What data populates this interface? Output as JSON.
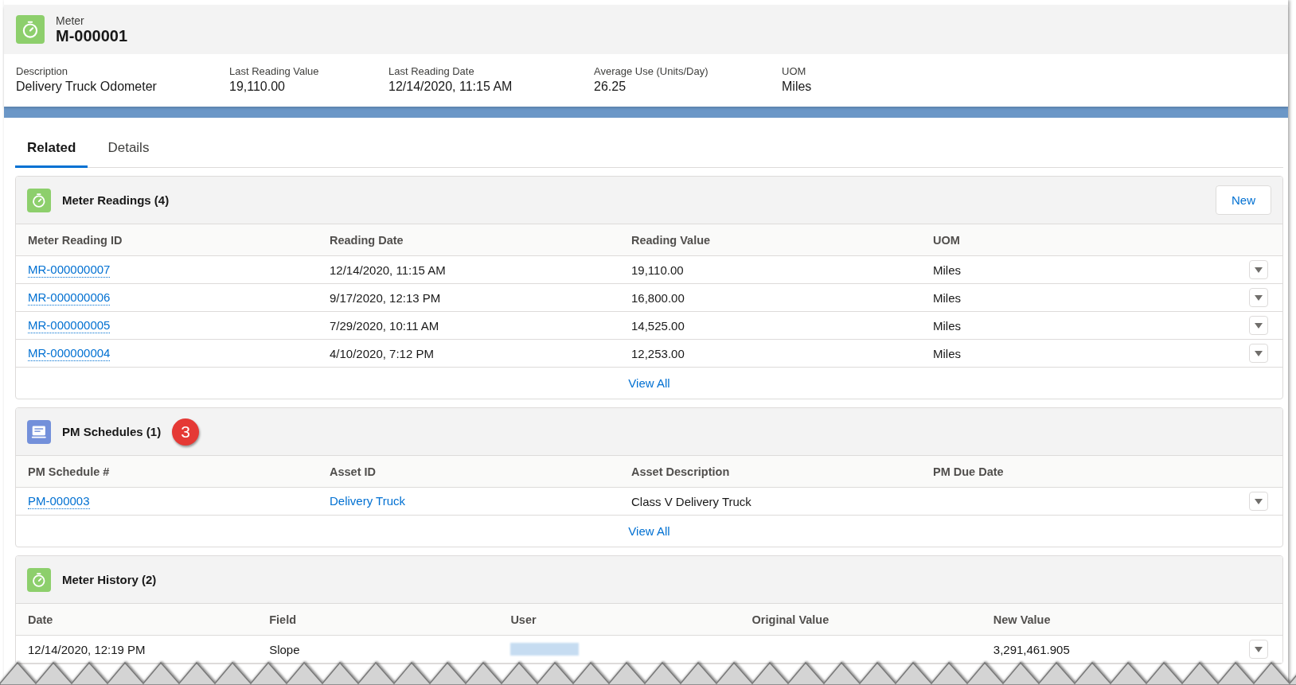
{
  "record": {
    "object_label": "Meter",
    "name": "M-000001",
    "kind": "meter"
  },
  "highlights": [
    {
      "label": "Description",
      "value": "Delivery Truck Odometer"
    },
    {
      "label": "Last Reading Value",
      "value": "19,110.00"
    },
    {
      "label": "Last Reading Date",
      "value": "12/14/2020, 11:15 AM"
    },
    {
      "label": "Average Use (Units/Day)",
      "value": "26.25"
    },
    {
      "label": "UOM",
      "value": "Miles"
    }
  ],
  "tabs": [
    {
      "label": "Related",
      "selected": true
    },
    {
      "label": "Details",
      "selected": false
    }
  ],
  "related_lists": [
    {
      "title": "Meter Readings (4)",
      "kind": "meter",
      "new_button": "New",
      "columns": [
        "Meter Reading ID",
        "Reading Date",
        "Reading Value",
        "UOM"
      ],
      "rows": [
        [
          {
            "kind": "link",
            "text": "MR-000000007"
          },
          {
            "kind": "text",
            "text": "12/14/2020, 11:15 AM"
          },
          {
            "kind": "text",
            "text": "19,110.00"
          },
          {
            "kind": "text",
            "text": "Miles"
          }
        ],
        [
          {
            "kind": "link",
            "text": "MR-000000006"
          },
          {
            "kind": "text",
            "text": "9/17/2020, 12:13 PM"
          },
          {
            "kind": "text",
            "text": "16,800.00"
          },
          {
            "kind": "text",
            "text": "Miles"
          }
        ],
        [
          {
            "kind": "link",
            "text": "MR-000000005"
          },
          {
            "kind": "text",
            "text": "7/29/2020, 10:11 AM"
          },
          {
            "kind": "text",
            "text": "14,525.00"
          },
          {
            "kind": "text",
            "text": "Miles"
          }
        ],
        [
          {
            "kind": "link",
            "text": "MR-000000004"
          },
          {
            "kind": "text",
            "text": "4/10/2020, 7:12 PM"
          },
          {
            "kind": "text",
            "text": "12,253.00"
          },
          {
            "kind": "text",
            "text": "Miles"
          }
        ]
      ],
      "view_all": "View All"
    },
    {
      "title": "PM Schedules (1)",
      "kind": "schedule",
      "callout": "3",
      "columns": [
        "PM Schedule #",
        "Asset ID",
        "Asset Description",
        "PM Due Date"
      ],
      "rows": [
        [
          {
            "kind": "link",
            "text": "PM-000003"
          },
          {
            "kind": "plainlink",
            "text": "Delivery Truck"
          },
          {
            "kind": "text",
            "text": "Class V Delivery Truck"
          },
          {
            "kind": "empty"
          }
        ]
      ],
      "view_all": "View All"
    },
    {
      "title": "Meter History (2)",
      "kind": "meter",
      "columns": [
        "Date",
        "Field",
        "User",
        "Original Value",
        "New Value"
      ],
      "rows": [
        [
          {
            "kind": "text",
            "text": "12/14/2020, 12:19 PM"
          },
          {
            "kind": "text",
            "text": "Slope"
          },
          {
            "kind": "redacted"
          },
          {
            "kind": "empty"
          },
          {
            "kind": "text",
            "text": "3,291,461.905"
          }
        ]
      ]
    }
  ]
}
